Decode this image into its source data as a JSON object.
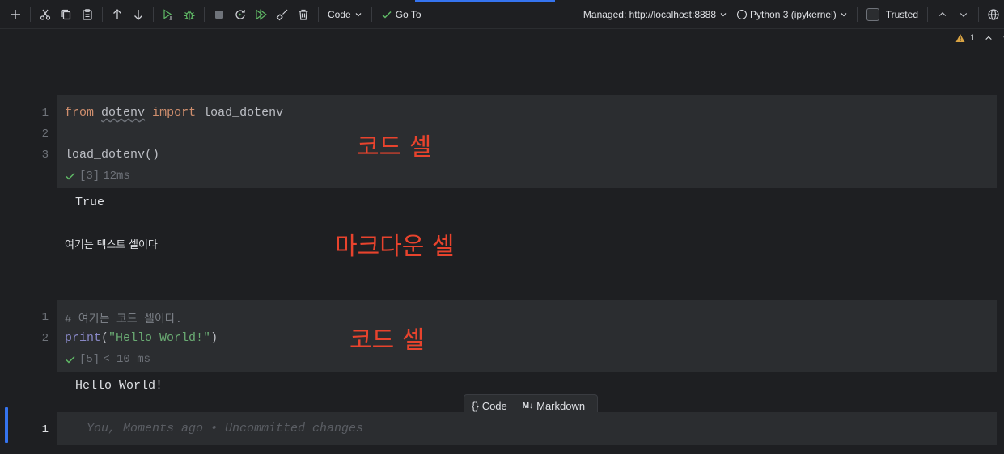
{
  "toolbar": {
    "cell_type": "Code",
    "goto_label": "Go To",
    "server_label": "Managed: http://localhost:8888",
    "kernel_label": "Python 3 (ipykernel)",
    "trusted_label": "Trusted"
  },
  "warnings": {
    "count": "1"
  },
  "cells": [
    {
      "line_numbers": [
        "1",
        "2",
        "3"
      ],
      "code": {
        "l1_kw1": "from",
        "l1_mod": "dotenv",
        "l1_kw2": "import",
        "l1_name": "load_dotenv",
        "l3": "load_dotenv()"
      },
      "exec_count": "[3]",
      "duration": "12ms",
      "output": "True"
    },
    {
      "markdown_text": "여기는 텍스트 셀이다"
    },
    {
      "line_numbers": [
        "1",
        "2"
      ],
      "code": {
        "l1_comment": "# 여기는 코드 셀이다.",
        "l2_fn": "print",
        "l2_open": "(",
        "l2_str": "\"Hello World!\"",
        "l2_close": ")"
      },
      "exec_count": "[5]",
      "duration": "< 10 ms",
      "output": "Hello World!"
    },
    {
      "line_numbers": [
        "1"
      ],
      "inlay_hint": "You, Moments ago • Uncommitted changes"
    }
  ],
  "annotations": {
    "code_cell_1": "코드 셀",
    "markdown_cell": "마크다운 셀",
    "code_cell_2": "코드 셀"
  },
  "add_cell_bar": {
    "code_label": "Code",
    "markdown_label": "Markdown",
    "code_glyph": "{}",
    "markdown_glyph": "M↓"
  },
  "colors": {
    "background": "#1e1f22",
    "cell_background": "#2b2d30",
    "annotation_red": "#e8432d",
    "run_green": "#5fb865",
    "accent_blue": "#3574f0"
  }
}
